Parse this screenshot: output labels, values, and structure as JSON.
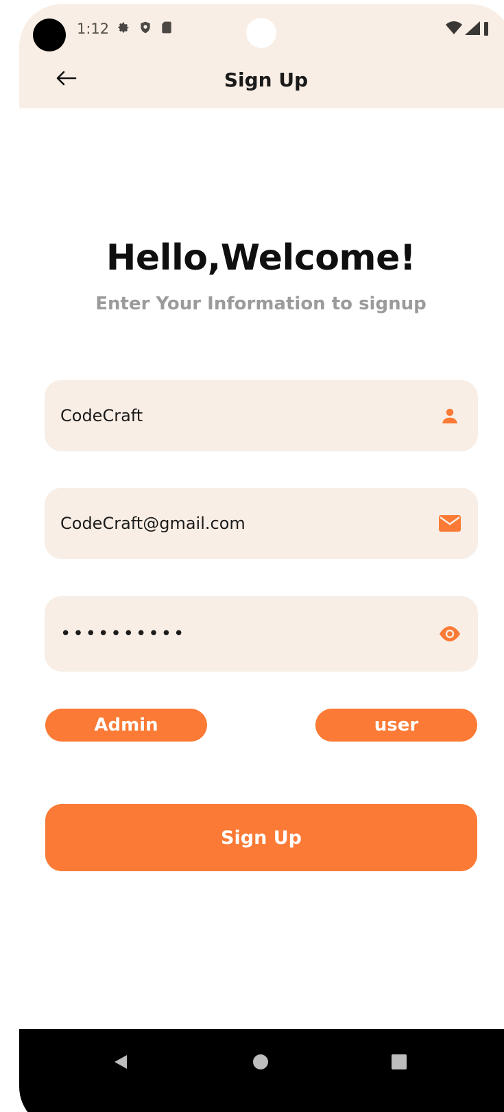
{
  "status_bar": {
    "time": "1:12"
  },
  "header": {
    "title": "Sign Up"
  },
  "welcome": {
    "title": "Hello,Welcome!",
    "subtitle": "Enter Your Information to signup"
  },
  "form": {
    "name_value": "CodeCraft",
    "email_value": "CodeCraft@gmail.com",
    "password_value": "••••••••••"
  },
  "roles": {
    "admin_label": "Admin",
    "user_label": "user"
  },
  "submit_label": "Sign Up",
  "colors": {
    "accent": "#fb7a35",
    "field_bg": "#f9eee5",
    "subtitle": "#9b9b9b"
  },
  "icons": {
    "back": "arrow-left-icon",
    "name": "person-icon",
    "email": "mail-icon",
    "password": "eye-icon"
  }
}
